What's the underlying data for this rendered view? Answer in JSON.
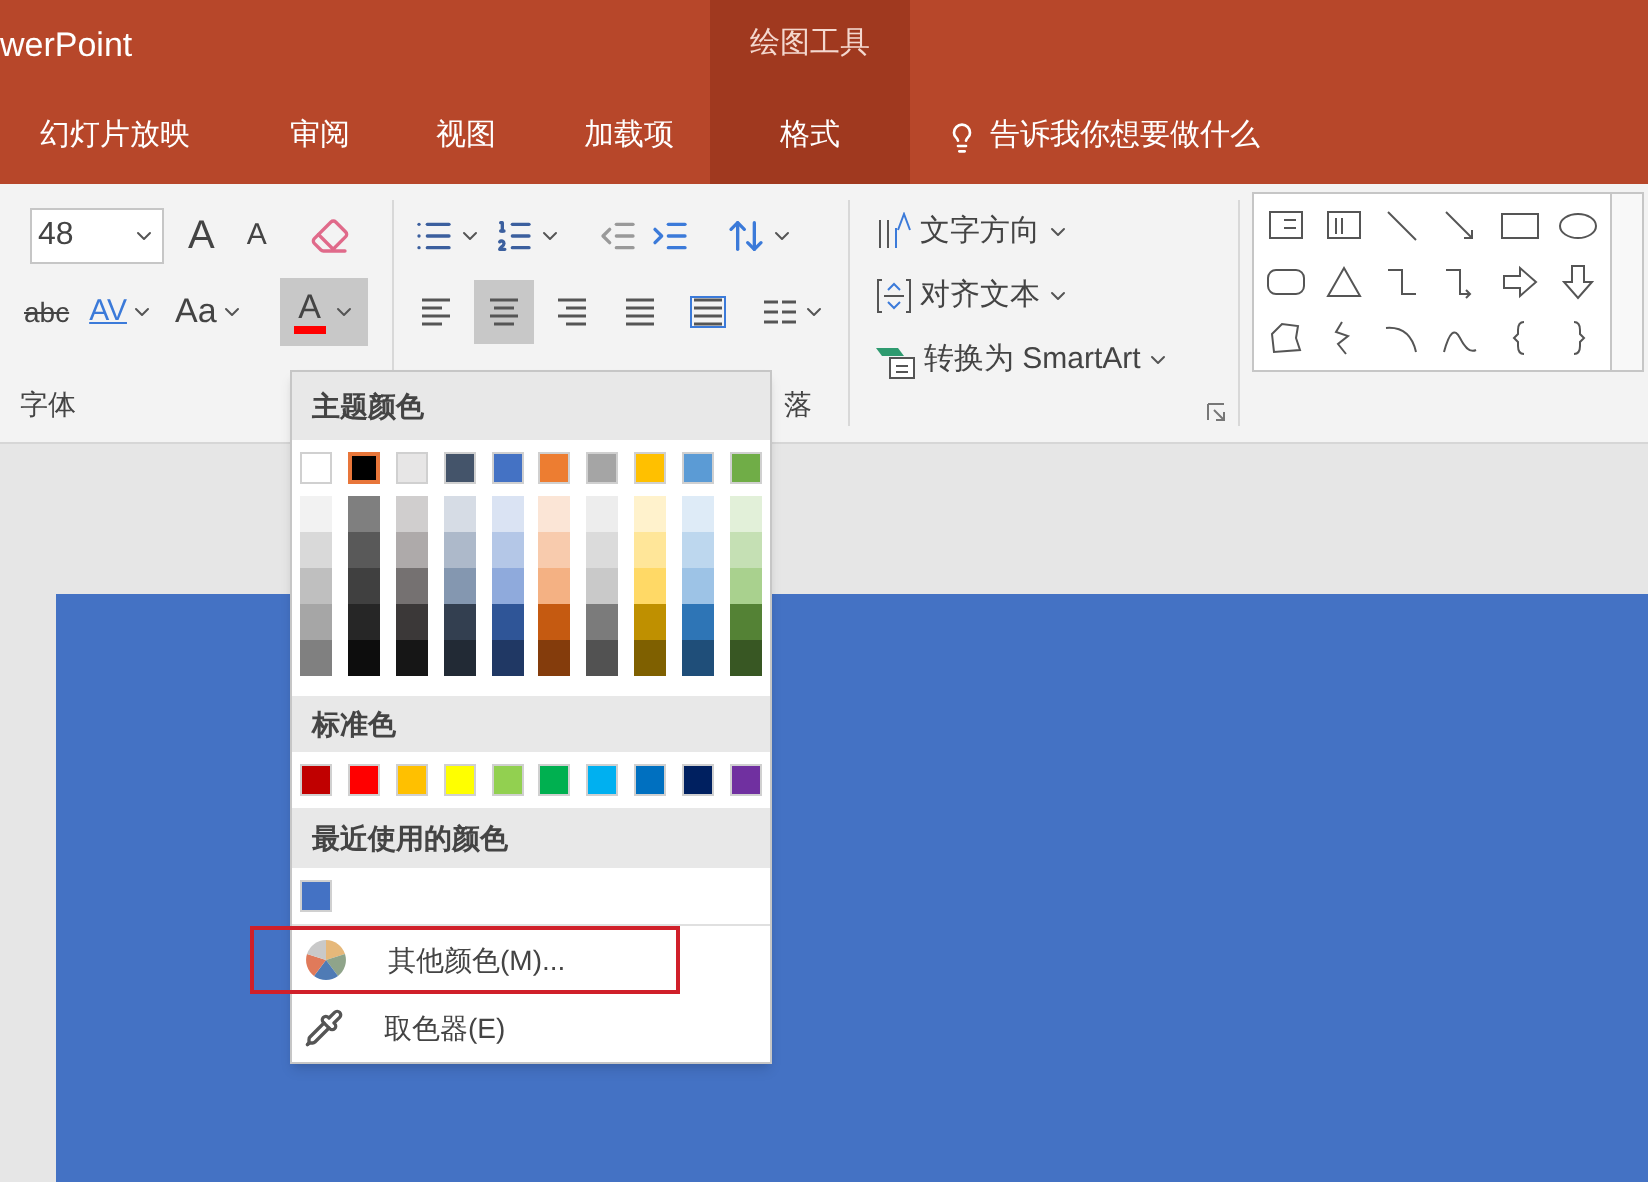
{
  "title_bar": {
    "app_title": "werPoint",
    "context_group": "绘图工具"
  },
  "tabs": [
    {
      "label": "幻灯片放映",
      "contextual": false
    },
    {
      "label": "审阅",
      "contextual": false
    },
    {
      "label": "视图",
      "contextual": false
    },
    {
      "label": "加载项",
      "contextual": false
    },
    {
      "label": "格式",
      "contextual": true
    }
  ],
  "tell_me": "告诉我你想要做什么",
  "ribbon": {
    "font_size": "48",
    "size_buttons": [
      {
        "label": "A",
        "kind": "grow"
      },
      {
        "label": "A",
        "kind": "shrink"
      }
    ],
    "font_buttons": [
      {
        "label": "abc",
        "kind": "strike"
      },
      {
        "label": "AV",
        "kind": "spacing"
      },
      {
        "label": "Aa",
        "kind": "case"
      }
    ],
    "font_color_button": {
      "label": "A",
      "color": "#ff0000",
      "pressed": true
    },
    "align_buttons": [
      {
        "kind": "left",
        "selected": false
      },
      {
        "kind": "center",
        "selected": true
      },
      {
        "kind": "right",
        "selected": false
      },
      {
        "kind": "justify",
        "selected": false
      },
      {
        "kind": "distributed",
        "selected": false
      }
    ],
    "text_commands": [
      {
        "label": "文字方向",
        "kind": "direction"
      },
      {
        "label": "对齐文本",
        "kind": "align"
      },
      {
        "label": "转换为 SmartArt",
        "kind": "smartart"
      }
    ],
    "group_labels": [
      "字体",
      "落"
    ]
  },
  "color_menu": {
    "theme_title": "主题颜色",
    "theme_colors": [
      {
        "color": "#ffffff",
        "selected": false,
        "shades": [
          {
            "color": "#f2f2f2"
          },
          {
            "color": "#d9d9d9"
          },
          {
            "color": "#bfbfbf"
          },
          {
            "color": "#a6a6a6"
          },
          {
            "color": "#808080"
          }
        ]
      },
      {
        "color": "#000000",
        "selected": true,
        "shades": [
          {
            "color": "#7f7f7f"
          },
          {
            "color": "#595959"
          },
          {
            "color": "#404040"
          },
          {
            "color": "#262626"
          },
          {
            "color": "#0d0d0d"
          }
        ]
      },
      {
        "color": "#e7e6e6",
        "selected": false,
        "shades": [
          {
            "color": "#d0cece"
          },
          {
            "color": "#aeaaaa"
          },
          {
            "color": "#757171"
          },
          {
            "color": "#3b3838"
          },
          {
            "color": "#161616"
          }
        ]
      },
      {
        "color": "#44546a",
        "selected": false,
        "shades": [
          {
            "color": "#d6dce5"
          },
          {
            "color": "#adb9ca"
          },
          {
            "color": "#8497b0"
          },
          {
            "color": "#333f50"
          },
          {
            "color": "#222a35"
          }
        ]
      },
      {
        "color": "#4472c4",
        "selected": false,
        "shades": [
          {
            "color": "#dae3f3"
          },
          {
            "color": "#b4c7e7"
          },
          {
            "color": "#8faadc"
          },
          {
            "color": "#2f5597"
          },
          {
            "color": "#203864"
          }
        ]
      },
      {
        "color": "#ed7d31",
        "selected": false,
        "shades": [
          {
            "color": "#fbe5d6"
          },
          {
            "color": "#f8cbad"
          },
          {
            "color": "#f4b183"
          },
          {
            "color": "#c55a11"
          },
          {
            "color": "#843c0c"
          }
        ]
      },
      {
        "color": "#a5a5a5",
        "selected": false,
        "shades": [
          {
            "color": "#ededed"
          },
          {
            "color": "#dbdbdb"
          },
          {
            "color": "#c9c9c9"
          },
          {
            "color": "#7b7b7b"
          },
          {
            "color": "#525252"
          }
        ]
      },
      {
        "color": "#ffc000",
        "selected": false,
        "shades": [
          {
            "color": "#fff2cc"
          },
          {
            "color": "#ffe699"
          },
          {
            "color": "#ffd966"
          },
          {
            "color": "#bf9000"
          },
          {
            "color": "#7f6000"
          }
        ]
      },
      {
        "color": "#5b9bd5",
        "selected": false,
        "shades": [
          {
            "color": "#deebf7"
          },
          {
            "color": "#bdd7ee"
          },
          {
            "color": "#9dc3e6"
          },
          {
            "color": "#2e75b6"
          },
          {
            "color": "#1f4e79"
          }
        ]
      },
      {
        "color": "#70ad47",
        "selected": false,
        "shades": [
          {
            "color": "#e2f0d9"
          },
          {
            "color": "#c5e0b4"
          },
          {
            "color": "#a9d18e"
          },
          {
            "color": "#548235"
          },
          {
            "color": "#385723"
          }
        ]
      }
    ],
    "standard_title": "标准色",
    "standard_colors": [
      {
        "color": "#c00000"
      },
      {
        "color": "#ff0000"
      },
      {
        "color": "#ffc000"
      },
      {
        "color": "#ffff00"
      },
      {
        "color": "#92d050"
      },
      {
        "color": "#00b050"
      },
      {
        "color": "#00b0f0"
      },
      {
        "color": "#0070c0"
      },
      {
        "color": "#002060"
      },
      {
        "color": "#7030a0"
      }
    ],
    "recent_title": "最近使用的颜色",
    "recent_colors": [
      {
        "color": "#4472c4"
      }
    ],
    "items": [
      {
        "label": "其他颜色(M)...",
        "kind": "more",
        "annotated": true
      },
      {
        "label": "取色器(E)",
        "kind": "eyedropper",
        "annotated": false
      }
    ]
  }
}
